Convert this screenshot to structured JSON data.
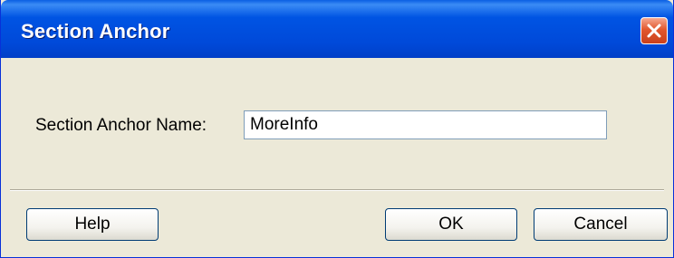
{
  "dialog": {
    "title": "Section Anchor",
    "close_icon": "close-icon",
    "field_label": "Section Anchor Name:",
    "field_value": "MoreInfo",
    "buttons": {
      "help": "Help",
      "ok": "OK",
      "cancel": "Cancel"
    }
  },
  "colors": {
    "titlebar": "#0054e3",
    "close_button": "#e2572d",
    "dialog_background": "#ece9d8"
  }
}
